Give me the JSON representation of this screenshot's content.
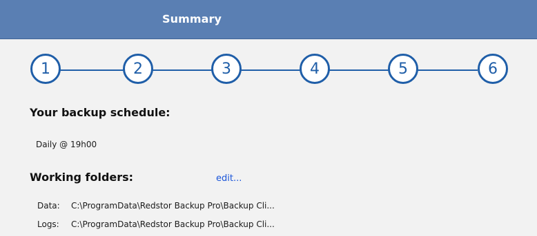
{
  "header": {
    "title": "Summary"
  },
  "steps": [
    "1",
    "2",
    "3",
    "4",
    "5",
    "6"
  ],
  "schedule": {
    "heading": "Your backup schedule:",
    "value": "Daily @ 19h00"
  },
  "folders": {
    "heading": "Working folders:",
    "edit_label": "edit...",
    "rows": [
      {
        "label": "Data:",
        "path": "C:\\ProgramData\\Redstor Backup Pro\\Backup Cli..."
      },
      {
        "label": "Logs:",
        "path": "C:\\ProgramData\\Redstor Backup Pro\\Backup Cli..."
      }
    ]
  },
  "colors": {
    "header": "#5a7fb3",
    "step": "#1f5ea8",
    "link": "#1a55d9"
  }
}
